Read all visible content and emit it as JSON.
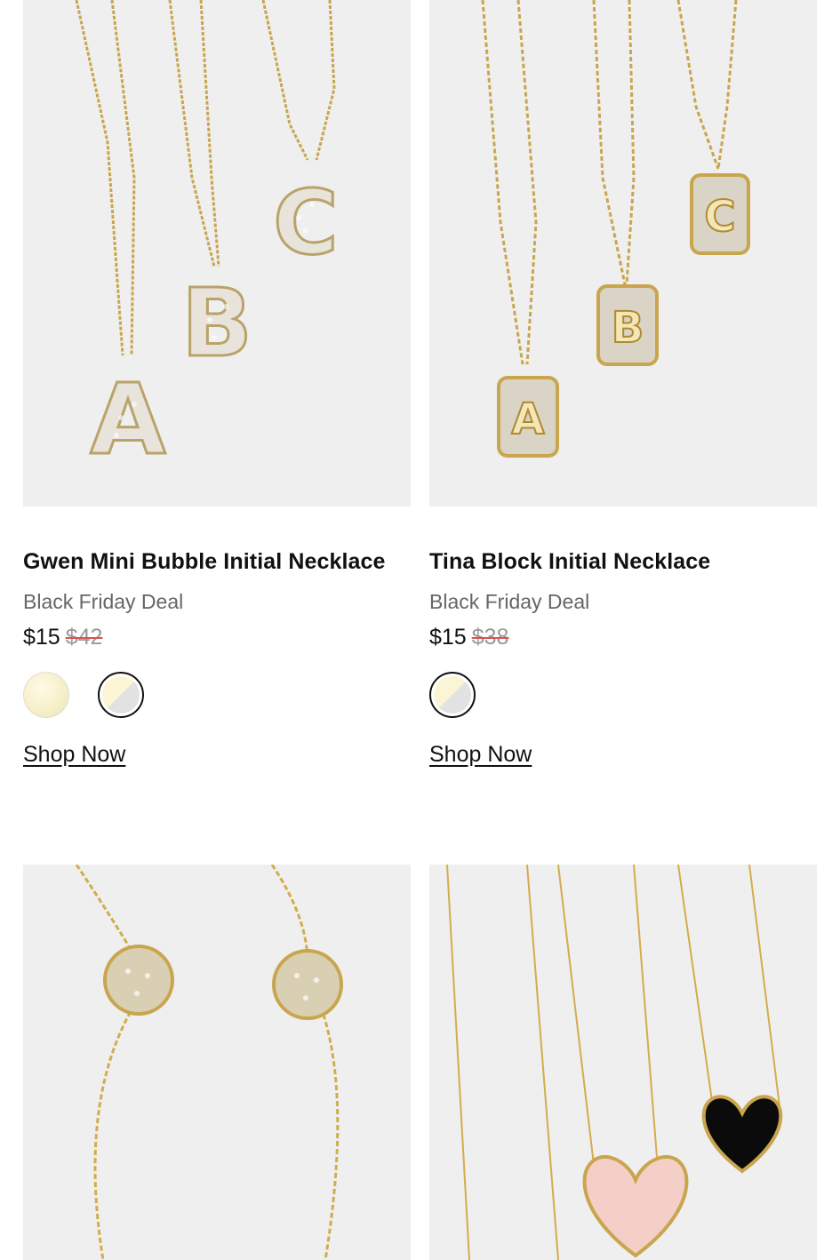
{
  "products": [
    {
      "title": "Gwen Mini Bubble Initial Necklace",
      "deal": "Black Friday Deal",
      "price": "$15",
      "old_price": "$42",
      "swatches": [
        "gold-swatch",
        "gold-silver-swatch"
      ],
      "cta": "Shop Now",
      "image_letters": [
        "A",
        "B",
        "C"
      ]
    },
    {
      "title": "Tina Block Initial Necklace",
      "deal": "Black Friday Deal",
      "price": "$15",
      "old_price": "$38",
      "swatches": [
        "gold-silver-swatch"
      ],
      "cta": "Shop Now",
      "image_letters": [
        "A",
        "B",
        "C"
      ]
    }
  ],
  "colors": {
    "image_bg": "#efefef",
    "gold": "#d4b15a",
    "strike": "#d9534f",
    "deal_text": "#666666"
  }
}
